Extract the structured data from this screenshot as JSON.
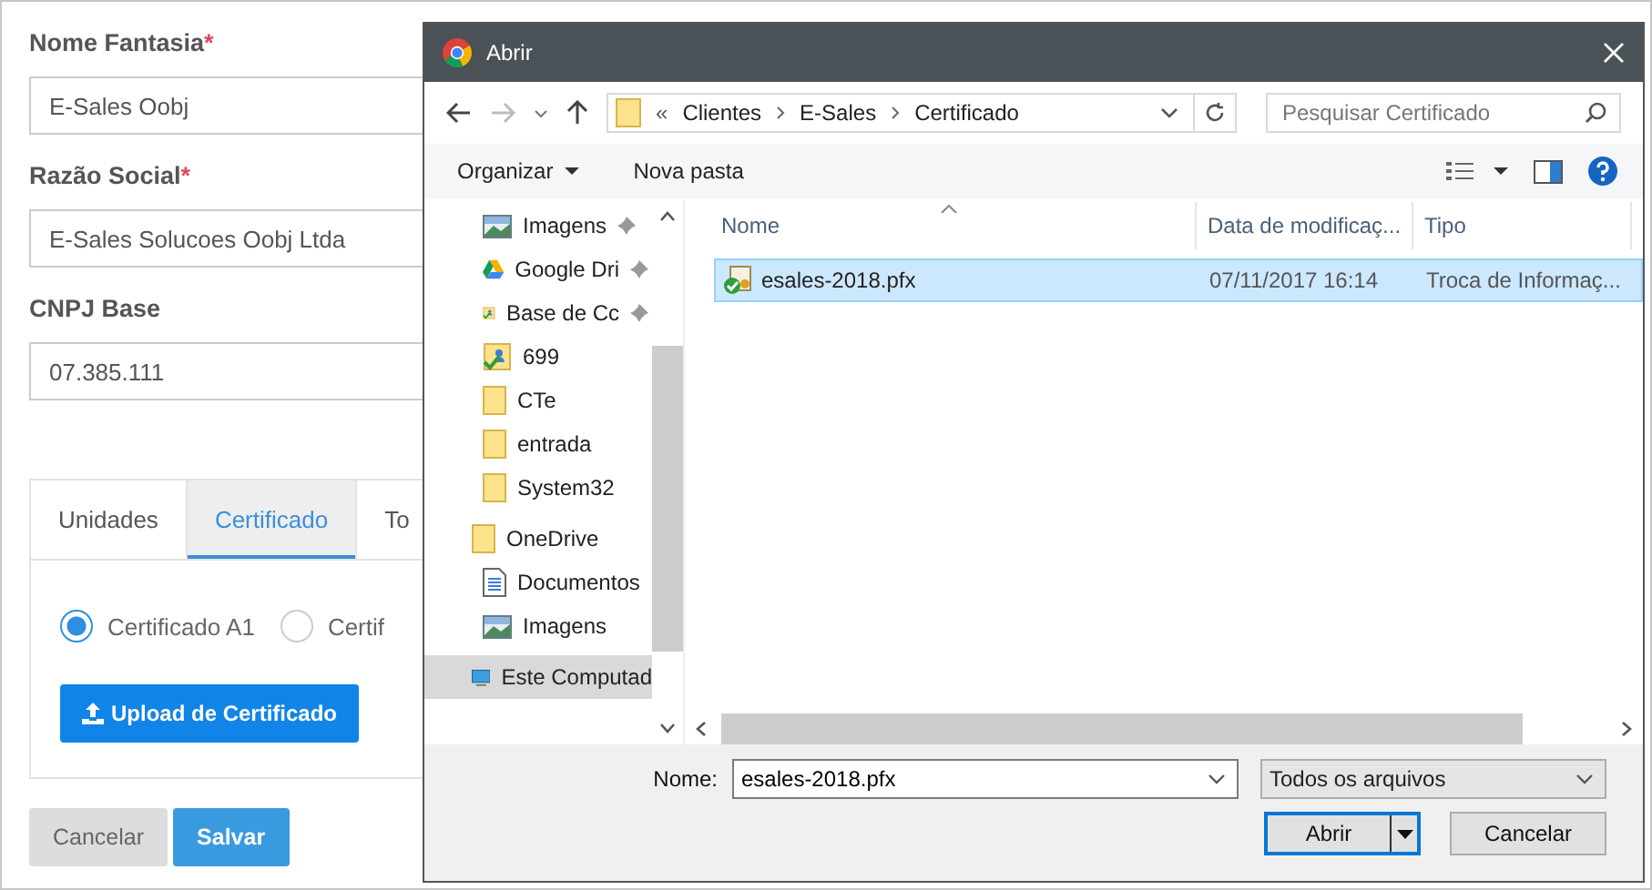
{
  "form": {
    "required_mark": "*",
    "fields": [
      {
        "label": "Nome Fantasia",
        "required": true,
        "value": "E-Sales Oobj"
      },
      {
        "label": "Razão Social",
        "required": true,
        "value": "E-Sales Solucoes Oobj Ltda"
      },
      {
        "label": "CNPJ Base",
        "required": false,
        "value": "07.385.111"
      }
    ],
    "tabs": [
      {
        "label": "Unidades",
        "selected": false
      },
      {
        "label": "Certificado",
        "selected": true
      },
      {
        "label": "To",
        "selected": false
      }
    ],
    "radios": [
      {
        "label": "Certificado A1",
        "selected": true
      },
      {
        "label": "Certif",
        "selected": false
      }
    ],
    "upload_button": "Upload de Certificado",
    "buttons": [
      {
        "label": "Cancelar",
        "kind": "secondary"
      },
      {
        "label": "Salvar",
        "kind": "primary"
      }
    ]
  },
  "dialog": {
    "title": "Abrir",
    "breadcrumb": {
      "overflow": "«",
      "parts": [
        "Clientes",
        "E-Sales",
        "Certificado"
      ]
    },
    "search": {
      "placeholder": "Pesquisar Certificado"
    },
    "toolbar": {
      "organize": "Organizar",
      "new_folder": "Nova pasta"
    },
    "nav_items": [
      {
        "label": "Imagens",
        "kind": "pictures",
        "pinned": true,
        "selected": false
      },
      {
        "label": "Google Dri",
        "kind": "drive",
        "pinned": true,
        "selected": false
      },
      {
        "label": "Base de Cc",
        "kind": "shared",
        "pinned": true,
        "selected": false
      },
      {
        "label": "699",
        "kind": "shared",
        "pinned": false,
        "selected": false
      },
      {
        "label": "CTe",
        "kind": "folder",
        "pinned": false,
        "selected": false
      },
      {
        "label": "entrada",
        "kind": "folder",
        "pinned": false,
        "selected": false
      },
      {
        "label": "System32",
        "kind": "folder",
        "pinned": false,
        "selected": false
      },
      {
        "label": "OneDrive",
        "kind": "root-folder",
        "pinned": false,
        "selected": false
      },
      {
        "label": "Documentos",
        "kind": "document",
        "pinned": false,
        "selected": false
      },
      {
        "label": "Imagens",
        "kind": "pictures",
        "pinned": false,
        "selected": false
      },
      {
        "label": "Este Computad",
        "kind": "computer",
        "pinned": false,
        "selected": true
      }
    ],
    "columns": [
      "Nome",
      "Data de modificaç...",
      "Tipo"
    ],
    "files": [
      {
        "name": "esales-2018.pfx",
        "modified": "07/11/2017 16:14",
        "type": "Troca de Informaç...",
        "selected": true
      }
    ],
    "filename_label": "Nome:",
    "filename": "esales-2018.pfx",
    "filter": "Todos os arquivos",
    "buttons": [
      {
        "label": "Abrir",
        "kind": "split"
      },
      {
        "label": "Cancelar",
        "kind": "plain"
      }
    ]
  }
}
